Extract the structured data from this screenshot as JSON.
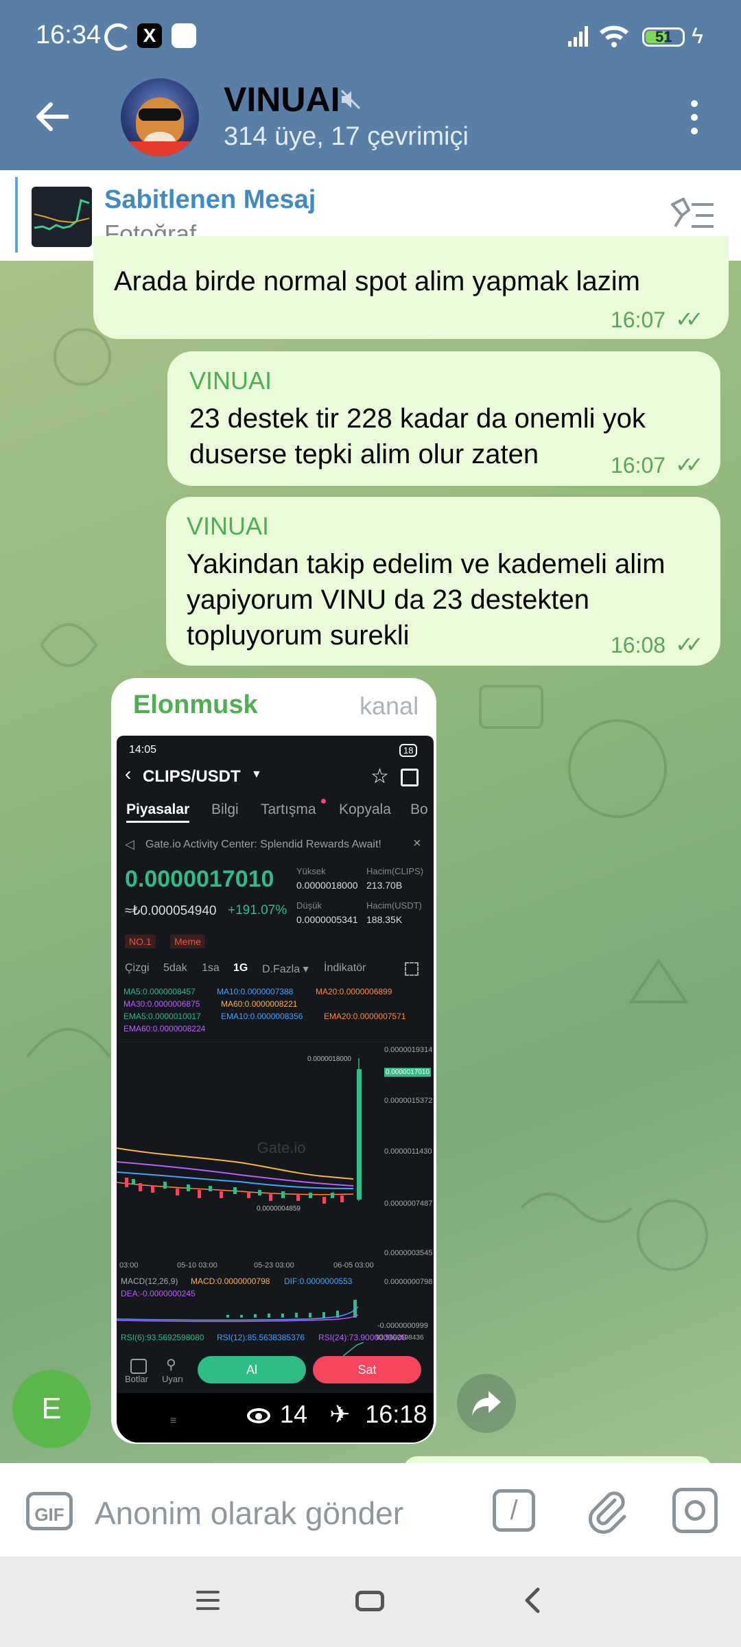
{
  "status_bar": {
    "time": "16:34",
    "battery": "51"
  },
  "header": {
    "title": "VINUAI",
    "subtitle": "314 üye, 17 çevrimiçi"
  },
  "pinned": {
    "title": "Sabitlenen Mesaj",
    "subtitle": "Fotoğraf"
  },
  "messages": [
    {
      "author": "",
      "text": "Arada birde normal spot alim yapmak lazim",
      "time": "16:07"
    },
    {
      "author": "VINUAI",
      "text": "23 destek tir 228 kadar da onemli yok duserse tepki alim olur zaten",
      "time": "16:07"
    },
    {
      "author": "VINUAI",
      "text": "Yakindan takip edelim ve kademeli alim yapiyorum VINU da 23 destekten topluyorum surekli",
      "time": "16:08"
    }
  ],
  "forwarded": {
    "author": "Elonmusk",
    "tag": "kanal",
    "views": "14",
    "time": "16:18",
    "sender_initial": "E",
    "screenshot": {
      "time": "14:05",
      "battery": "18",
      "pair": "CLIPS/USDT",
      "tabs": [
        "Piyasalar",
        "Bilgi",
        "Tartışma",
        "Kopyala",
        "Bo"
      ],
      "banner": "Gate.io Activity Center: Splendid Rewards Await!",
      "price": "0.0000017010",
      "price_try": "≈₺0.000054940",
      "change": "+191.07%",
      "high_label": "Yüksek",
      "high": "0.0000018000",
      "vol_clips_label": "Hacim(CLIPS)",
      "vol_clips": "213.70B",
      "low_label": "Düşük",
      "low": "0.0000005341",
      "vol_usdt_label": "Hacim(USDT)",
      "vol_usdt": "188.35K",
      "badges": [
        "NO.1",
        "Meme"
      ],
      "intervals": [
        "Çizgi",
        "5dak",
        "1sa",
        "1G",
        "D.Fazla ▾",
        "İndikatör"
      ],
      "ma_lines": [
        [
          "MA5:0.0000008457",
          "MA10:0.0000007388",
          "MA20:0.0000006899"
        ],
        [
          "MA30:0.0000006875",
          "MA60:0.0000008221"
        ],
        [
          "EMA5:0.0000010017",
          "EMA10:0.0000008356",
          "EMA20:0.0000007571"
        ],
        [
          "EMA60:0.0000008224"
        ]
      ],
      "axis_prices": [
        "0.0000019314",
        "0.0000015372",
        "0.0000011430",
        "0.0000007487",
        "0.0000003545"
      ],
      "high_marker": "0.0000018000",
      "low_marker": "0.0000004859",
      "current_marker": "0.0000017010",
      "watermark": "Gate.io",
      "dates": [
        "03:00",
        "05-10 03:00",
        "05-23 03:00",
        "06-05 03:00"
      ],
      "macd_label": "MACD(12,26,9)",
      "macd": "MACD:0.0000000798",
      "dif": "DIF:0.0000000553",
      "dea": "DEA:-0.0000000245",
      "macd_axis": [
        "0.0000000798",
        "-0.0000000999"
      ],
      "rsi": [
        "RSI(6):93.5692598080",
        "RSI(12):85.5638385376",
        "RSI(24):73.9000000000"
      ],
      "rsi_axis": "93.5692598436",
      "bottom": {
        "bots": "Botlar",
        "alert": "Uyarı",
        "buy": "Al",
        "sell": "Sat"
      }
    }
  },
  "input": {
    "placeholder": "Anonim olarak gönder",
    "gif": "GIF"
  }
}
